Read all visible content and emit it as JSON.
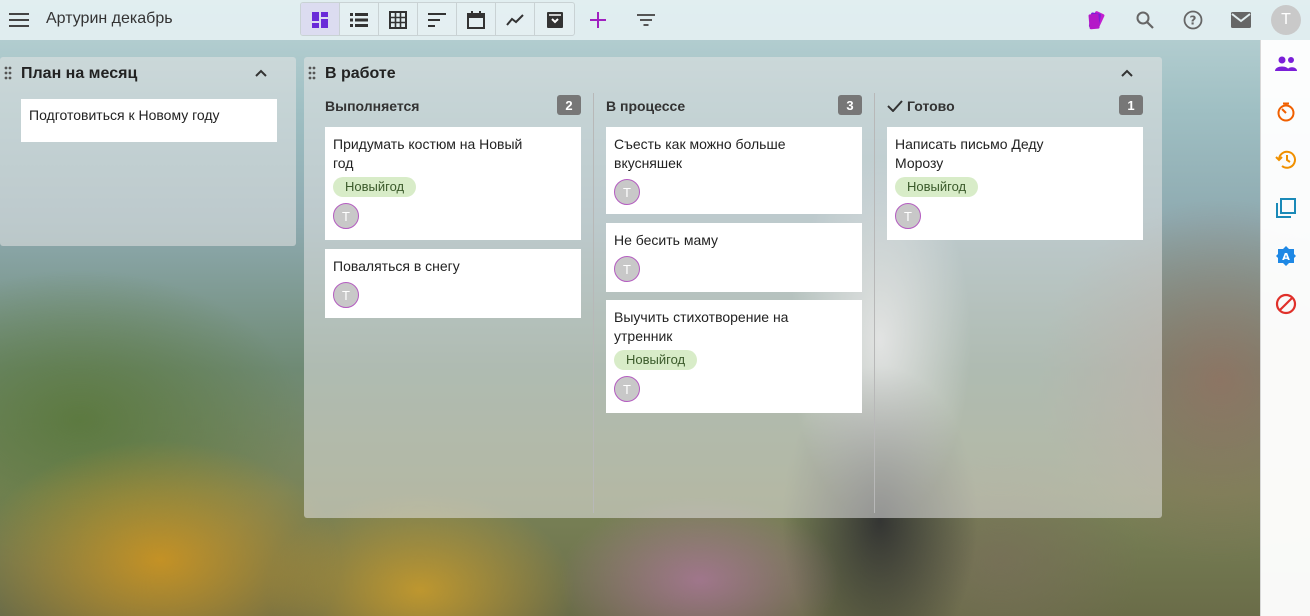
{
  "header": {
    "board_title": "Артурин декабрь",
    "menu_icon": "hamburger-menu-icon",
    "avatar_initial": "T",
    "accent_color": "#6a2bd8",
    "add_color": "#a020c0"
  },
  "view_modes": [
    {
      "name": "kanban-view-icon",
      "active": true
    },
    {
      "name": "list-view-icon",
      "active": false
    },
    {
      "name": "table-view-icon",
      "active": false
    },
    {
      "name": "gantt-view-icon",
      "active": false
    },
    {
      "name": "calendar-view-icon",
      "active": false
    },
    {
      "name": "chart-view-icon",
      "active": false
    },
    {
      "name": "archive-view-icon",
      "active": false
    }
  ],
  "sidebar_icons": [
    "users-icon",
    "timer-icon",
    "history-icon",
    "copy-icon",
    "badge-icon",
    "block-icon"
  ],
  "panels": {
    "plan": {
      "title": "План на месяц",
      "cards": [
        "Подготовиться к Новому году"
      ]
    },
    "work": {
      "title": "В работе",
      "columns": [
        {
          "title": "Выполняется",
          "count": "2",
          "cards": [
            {
              "title": "Придумать костюм на Новый\nгод",
              "tag": "Новыйгод",
              "avatar": "T"
            },
            {
              "title": "Поваляться в снегу",
              "avatar": "T"
            }
          ]
        },
        {
          "title": "В процессе",
          "count": "3",
          "cards": [
            {
              "title": "Съесть как можно больше\nвкусняшек",
              "avatar": "T"
            },
            {
              "title": "Не бесить маму",
              "avatar": "T"
            },
            {
              "title": "Выучить стихотворение на\nутренник",
              "tag": "Новыйгод",
              "avatar": "T"
            }
          ]
        },
        {
          "title": "Готово",
          "count": "1",
          "cards": [
            {
              "title": "Написать письмо Деду\nМорозу",
              "tag": "Новыйгод",
              "avatar": "T"
            }
          ]
        }
      ]
    }
  }
}
